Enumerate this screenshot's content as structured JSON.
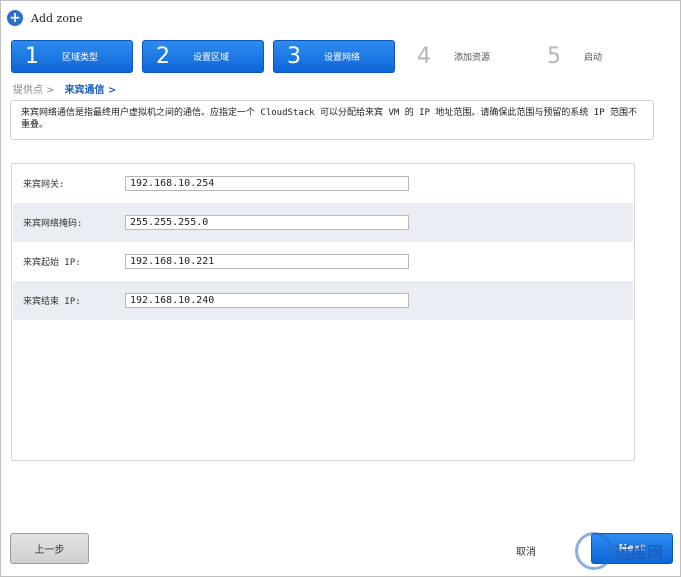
{
  "header": {
    "title": "Add zone",
    "icon": "plus-circle-icon"
  },
  "steps": [
    {
      "num": "1",
      "label": "区域类型",
      "state": "active"
    },
    {
      "num": "2",
      "label": "设置区域",
      "state": "active"
    },
    {
      "num": "3",
      "label": "设置网络",
      "state": "active"
    },
    {
      "num": "4",
      "label": "添加资源",
      "state": "inactive"
    },
    {
      "num": "5",
      "label": "启动",
      "state": "inactive"
    }
  ],
  "breadcrumb": [
    {
      "label": "提供点 >",
      "active": false
    },
    {
      "label": "来宾通信 >",
      "active": true
    }
  ],
  "info_text": "来宾网络通信是指最终用户虚拟机之间的通信。应指定一个 CloudStack 可以分配给来宾 VM 的 IP 地址范围。请确保此范围与预留的系统 IP 范围不重叠。",
  "form": {
    "fields": [
      {
        "label": "来宾网关:",
        "value": "192.168.10.254"
      },
      {
        "label": "来宾网络掩码:",
        "value": "255.255.255.0"
      },
      {
        "label": "来宾起始 IP:",
        "value": "192.168.10.221"
      },
      {
        "label": "来宾结束 IP:",
        "value": "192.168.10.240"
      }
    ]
  },
  "buttons": {
    "prev": "上一步",
    "cancel": "取消",
    "next": "Next"
  },
  "watermark": "运维网",
  "colors": {
    "accent": "#1a73e0",
    "alt_row": "#eaeef4"
  }
}
